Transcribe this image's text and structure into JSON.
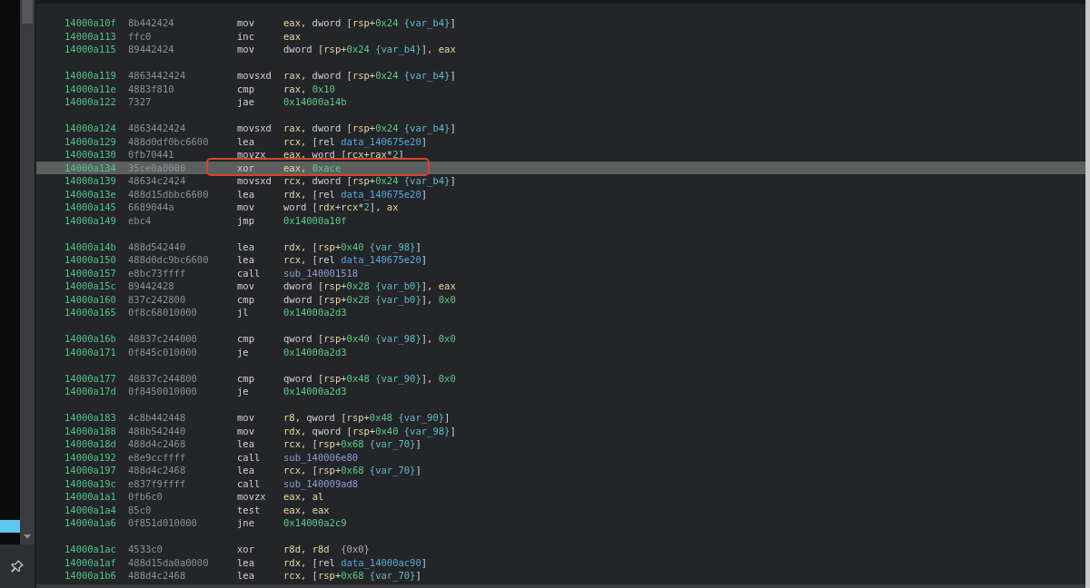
{
  "disassembly": {
    "blocks": [
      {
        "lines": [
          {
            "address": "14000a10f",
            "bytes": "8b442424",
            "mnemonic": "mov",
            "operands": [
              {
                "kind": "reg",
                "text": "eax"
              },
              {
                "kind": "p",
                "text": ", dword ["
              },
              {
                "kind": "reg",
                "text": "rsp"
              },
              {
                "kind": "p",
                "text": "+"
              },
              {
                "kind": "num",
                "text": "0x24"
              },
              {
                "kind": "var",
                "text": " {var_b4}"
              },
              {
                "kind": "p",
                "text": "]"
              }
            ],
            "selected": false,
            "marked": false
          },
          {
            "address": "14000a113",
            "bytes": "ffc0",
            "mnemonic": "inc",
            "operands": [
              {
                "kind": "reg",
                "text": "eax"
              }
            ],
            "selected": false,
            "marked": false
          },
          {
            "address": "14000a115",
            "bytes": "89442424",
            "mnemonic": "mov",
            "operands": [
              {
                "kind": "p",
                "text": "dword ["
              },
              {
                "kind": "reg",
                "text": "rsp"
              },
              {
                "kind": "p",
                "text": "+"
              },
              {
                "kind": "num",
                "text": "0x24"
              },
              {
                "kind": "var",
                "text": " {var_b4}"
              },
              {
                "kind": "p",
                "text": "], "
              },
              {
                "kind": "reg",
                "text": "eax"
              }
            ],
            "selected": false,
            "marked": false
          }
        ]
      },
      {
        "lines": [
          {
            "address": "14000a119",
            "bytes": "4863442424",
            "mnemonic": "movsxd",
            "operands": [
              {
                "kind": "reg",
                "text": "rax"
              },
              {
                "kind": "p",
                "text": ", dword ["
              },
              {
                "kind": "reg",
                "text": "rsp"
              },
              {
                "kind": "p",
                "text": "+"
              },
              {
                "kind": "num",
                "text": "0x24"
              },
              {
                "kind": "var",
                "text": " {var_b4}"
              },
              {
                "kind": "p",
                "text": "]"
              }
            ],
            "selected": false,
            "marked": false
          },
          {
            "address": "14000a11e",
            "bytes": "4883f810",
            "mnemonic": "cmp",
            "operands": [
              {
                "kind": "reg",
                "text": "rax"
              },
              {
                "kind": "p",
                "text": ", "
              },
              {
                "kind": "num",
                "text": "0x10"
              }
            ],
            "selected": false,
            "marked": false
          },
          {
            "address": "14000a122",
            "bytes": "7327",
            "mnemonic": "jae",
            "operands": [
              {
                "kind": "num",
                "text": "0x14000a14b"
              }
            ],
            "selected": false,
            "marked": false
          }
        ]
      },
      {
        "lines": [
          {
            "address": "14000a124",
            "bytes": "4863442424",
            "mnemonic": "movsxd",
            "operands": [
              {
                "kind": "reg",
                "text": "rax"
              },
              {
                "kind": "p",
                "text": ", dword ["
              },
              {
                "kind": "reg",
                "text": "rsp"
              },
              {
                "kind": "p",
                "text": "+"
              },
              {
                "kind": "num",
                "text": "0x24"
              },
              {
                "kind": "var",
                "text": " {var_b4}"
              },
              {
                "kind": "p",
                "text": "]"
              }
            ],
            "selected": false,
            "marked": false
          },
          {
            "address": "14000a129",
            "bytes": "488d0df0bc6600",
            "mnemonic": "lea",
            "operands": [
              {
                "kind": "reg",
                "text": "rcx"
              },
              {
                "kind": "p",
                "text": ", [rel "
              },
              {
                "kind": "data",
                "text": "data_140675e20"
              },
              {
                "kind": "p",
                "text": "]"
              }
            ],
            "selected": false,
            "marked": false
          },
          {
            "address": "14000a130",
            "bytes": "0fb70441",
            "mnemonic": "movzx",
            "operands": [
              {
                "kind": "reg",
                "text": "eax"
              },
              {
                "kind": "p",
                "text": ", word ["
              },
              {
                "kind": "reg",
                "text": "rcx"
              },
              {
                "kind": "p",
                "text": "+"
              },
              {
                "kind": "reg",
                "text": "rax"
              },
              {
                "kind": "p",
                "text": "*"
              },
              {
                "kind": "num",
                "text": "2"
              },
              {
                "kind": "p",
                "text": "]"
              }
            ],
            "selected": false,
            "marked": false
          },
          {
            "address": "14000a134",
            "bytes": "35ce0a0000",
            "mnemonic": "xor",
            "operands": [
              {
                "kind": "reg",
                "text": "eax"
              },
              {
                "kind": "p",
                "text": ", "
              },
              {
                "kind": "num",
                "text": "0xace"
              }
            ],
            "selected": true,
            "marked": true
          },
          {
            "address": "14000a139",
            "bytes": "48634c2424",
            "mnemonic": "movsxd",
            "operands": [
              {
                "kind": "reg",
                "text": "rcx"
              },
              {
                "kind": "p",
                "text": ", dword ["
              },
              {
                "kind": "reg",
                "text": "rsp"
              },
              {
                "kind": "p",
                "text": "+"
              },
              {
                "kind": "num",
                "text": "0x24"
              },
              {
                "kind": "var",
                "text": " {var_b4}"
              },
              {
                "kind": "p",
                "text": "]"
              }
            ],
            "selected": false,
            "marked": false
          },
          {
            "address": "14000a13e",
            "bytes": "488d15dbbc6600",
            "mnemonic": "lea",
            "operands": [
              {
                "kind": "reg",
                "text": "rdx"
              },
              {
                "kind": "p",
                "text": ", [rel "
              },
              {
                "kind": "data",
                "text": "data_140675e20"
              },
              {
                "kind": "p",
                "text": "]"
              }
            ],
            "selected": false,
            "marked": false
          },
          {
            "address": "14000a145",
            "bytes": "6689044a",
            "mnemonic": "mov",
            "operands": [
              {
                "kind": "p",
                "text": "word ["
              },
              {
                "kind": "reg",
                "text": "rdx"
              },
              {
                "kind": "p",
                "text": "+"
              },
              {
                "kind": "reg",
                "text": "rcx"
              },
              {
                "kind": "p",
                "text": "*"
              },
              {
                "kind": "num",
                "text": "2"
              },
              {
                "kind": "p",
                "text": "], "
              },
              {
                "kind": "reg",
                "text": "ax"
              }
            ],
            "selected": false,
            "marked": false
          },
          {
            "address": "14000a149",
            "bytes": "ebc4",
            "mnemonic": "jmp",
            "operands": [
              {
                "kind": "num",
                "text": "0x14000a10f"
              }
            ],
            "selected": false,
            "marked": false
          }
        ]
      },
      {
        "lines": [
          {
            "address": "14000a14b",
            "bytes": "488d542440",
            "mnemonic": "lea",
            "operands": [
              {
                "kind": "reg",
                "text": "rdx"
              },
              {
                "kind": "p",
                "text": ", ["
              },
              {
                "kind": "reg",
                "text": "rsp"
              },
              {
                "kind": "p",
                "text": "+"
              },
              {
                "kind": "num",
                "text": "0x40"
              },
              {
                "kind": "var",
                "text": " {var_98}"
              },
              {
                "kind": "p",
                "text": "]"
              }
            ],
            "selected": false,
            "marked": false
          },
          {
            "address": "14000a150",
            "bytes": "488d0dc9bc6600",
            "mnemonic": "lea",
            "operands": [
              {
                "kind": "reg",
                "text": "rcx"
              },
              {
                "kind": "p",
                "text": ", [rel "
              },
              {
                "kind": "data",
                "text": "data_140675e20"
              },
              {
                "kind": "p",
                "text": "]"
              }
            ],
            "selected": false,
            "marked": false
          },
          {
            "address": "14000a157",
            "bytes": "e8bc73ffff",
            "mnemonic": "call",
            "operands": [
              {
                "kind": "func",
                "text": "sub_140001518"
              }
            ],
            "selected": false,
            "marked": false
          },
          {
            "address": "14000a15c",
            "bytes": "89442428",
            "mnemonic": "mov",
            "operands": [
              {
                "kind": "p",
                "text": "dword ["
              },
              {
                "kind": "reg",
                "text": "rsp"
              },
              {
                "kind": "p",
                "text": "+"
              },
              {
                "kind": "num",
                "text": "0x28"
              },
              {
                "kind": "var",
                "text": " {var_b0}"
              },
              {
                "kind": "p",
                "text": "], "
              },
              {
                "kind": "reg",
                "text": "eax"
              }
            ],
            "selected": false,
            "marked": false
          },
          {
            "address": "14000a160",
            "bytes": "837c242800",
            "mnemonic": "cmp",
            "operands": [
              {
                "kind": "p",
                "text": "dword ["
              },
              {
                "kind": "reg",
                "text": "rsp"
              },
              {
                "kind": "p",
                "text": "+"
              },
              {
                "kind": "num",
                "text": "0x28"
              },
              {
                "kind": "var",
                "text": " {var_b0}"
              },
              {
                "kind": "p",
                "text": "], "
              },
              {
                "kind": "num",
                "text": "0x0"
              }
            ],
            "selected": false,
            "marked": false
          },
          {
            "address": "14000a165",
            "bytes": "0f8c68010000",
            "mnemonic": "jl",
            "operands": [
              {
                "kind": "num",
                "text": "0x14000a2d3"
              }
            ],
            "selected": false,
            "marked": false
          }
        ]
      },
      {
        "lines": [
          {
            "address": "14000a16b",
            "bytes": "48837c244000",
            "mnemonic": "cmp",
            "operands": [
              {
                "kind": "p",
                "text": "qword ["
              },
              {
                "kind": "reg",
                "text": "rsp"
              },
              {
                "kind": "p",
                "text": "+"
              },
              {
                "kind": "num",
                "text": "0x40"
              },
              {
                "kind": "var",
                "text": " {var_98}"
              },
              {
                "kind": "p",
                "text": "], "
              },
              {
                "kind": "num",
                "text": "0x0"
              }
            ],
            "selected": false,
            "marked": false
          },
          {
            "address": "14000a171",
            "bytes": "0f845c010000",
            "mnemonic": "je",
            "operands": [
              {
                "kind": "num",
                "text": "0x14000a2d3"
              }
            ],
            "selected": false,
            "marked": false
          }
        ]
      },
      {
        "lines": [
          {
            "address": "14000a177",
            "bytes": "48837c244800",
            "mnemonic": "cmp",
            "operands": [
              {
                "kind": "p",
                "text": "qword ["
              },
              {
                "kind": "reg",
                "text": "rsp"
              },
              {
                "kind": "p",
                "text": "+"
              },
              {
                "kind": "num",
                "text": "0x48"
              },
              {
                "kind": "var",
                "text": " {var_90}"
              },
              {
                "kind": "p",
                "text": "], "
              },
              {
                "kind": "num",
                "text": "0x0"
              }
            ],
            "selected": false,
            "marked": false
          },
          {
            "address": "14000a17d",
            "bytes": "0f8450010000",
            "mnemonic": "je",
            "operands": [
              {
                "kind": "num",
                "text": "0x14000a2d3"
              }
            ],
            "selected": false,
            "marked": false
          }
        ]
      },
      {
        "lines": [
          {
            "address": "14000a183",
            "bytes": "4c8b442448",
            "mnemonic": "mov",
            "operands": [
              {
                "kind": "reg",
                "text": "r8"
              },
              {
                "kind": "p",
                "text": ", qword ["
              },
              {
                "kind": "reg",
                "text": "rsp"
              },
              {
                "kind": "p",
                "text": "+"
              },
              {
                "kind": "num",
                "text": "0x48"
              },
              {
                "kind": "var",
                "text": " {var_90}"
              },
              {
                "kind": "p",
                "text": "]"
              }
            ],
            "selected": false,
            "marked": false
          },
          {
            "address": "14000a188",
            "bytes": "488b542440",
            "mnemonic": "mov",
            "operands": [
              {
                "kind": "reg",
                "text": "rdx"
              },
              {
                "kind": "p",
                "text": ", qword ["
              },
              {
                "kind": "reg",
                "text": "rsp"
              },
              {
                "kind": "p",
                "text": "+"
              },
              {
                "kind": "num",
                "text": "0x40"
              },
              {
                "kind": "var",
                "text": " {var_98}"
              },
              {
                "kind": "p",
                "text": "]"
              }
            ],
            "selected": false,
            "marked": false
          },
          {
            "address": "14000a18d",
            "bytes": "488d4c2468",
            "mnemonic": "lea",
            "operands": [
              {
                "kind": "reg",
                "text": "rcx"
              },
              {
                "kind": "p",
                "text": ", ["
              },
              {
                "kind": "reg",
                "text": "rsp"
              },
              {
                "kind": "p",
                "text": "+"
              },
              {
                "kind": "num",
                "text": "0x68"
              },
              {
                "kind": "var",
                "text": " {var_70}"
              },
              {
                "kind": "p",
                "text": "]"
              }
            ],
            "selected": false,
            "marked": false
          },
          {
            "address": "14000a192",
            "bytes": "e8e9ccffff",
            "mnemonic": "call",
            "operands": [
              {
                "kind": "func",
                "text": "sub_140006e80"
              }
            ],
            "selected": false,
            "marked": false
          },
          {
            "address": "14000a197",
            "bytes": "488d4c2468",
            "mnemonic": "lea",
            "operands": [
              {
                "kind": "reg",
                "text": "rcx"
              },
              {
                "kind": "p",
                "text": ", ["
              },
              {
                "kind": "reg",
                "text": "rsp"
              },
              {
                "kind": "p",
                "text": "+"
              },
              {
                "kind": "num",
                "text": "0x68"
              },
              {
                "kind": "var",
                "text": " {var_70}"
              },
              {
                "kind": "p",
                "text": "]"
              }
            ],
            "selected": false,
            "marked": false
          },
          {
            "address": "14000a19c",
            "bytes": "e837f9ffff",
            "mnemonic": "call",
            "operands": [
              {
                "kind": "func",
                "text": "sub_140009ad8"
              }
            ],
            "selected": false,
            "marked": false
          },
          {
            "address": "14000a1a1",
            "bytes": "0fb6c0",
            "mnemonic": "movzx",
            "operands": [
              {
                "kind": "reg",
                "text": "eax"
              },
              {
                "kind": "p",
                "text": ", "
              },
              {
                "kind": "reg",
                "text": "al"
              }
            ],
            "selected": false,
            "marked": false
          },
          {
            "address": "14000a1a4",
            "bytes": "85c0",
            "mnemonic": "test",
            "operands": [
              {
                "kind": "reg",
                "text": "eax"
              },
              {
                "kind": "p",
                "text": ", "
              },
              {
                "kind": "reg",
                "text": "eax"
              }
            ],
            "selected": false,
            "marked": false
          },
          {
            "address": "14000a1a6",
            "bytes": "0f851d010000",
            "mnemonic": "jne",
            "operands": [
              {
                "kind": "num",
                "text": "0x14000a2c9"
              }
            ],
            "selected": false,
            "marked": false
          }
        ]
      },
      {
        "lines": [
          {
            "address": "14000a1ac",
            "bytes": "4533c0",
            "mnemonic": "xor",
            "operands": [
              {
                "kind": "reg",
                "text": "r8d"
              },
              {
                "kind": "p",
                "text": ", "
              },
              {
                "kind": "reg",
                "text": "r8d"
              },
              {
                "kind": "cmt",
                "text": "  {0x0}"
              }
            ],
            "selected": false,
            "marked": false
          },
          {
            "address": "14000a1af",
            "bytes": "488d15da0a0000",
            "mnemonic": "lea",
            "operands": [
              {
                "kind": "reg",
                "text": "rdx"
              },
              {
                "kind": "p",
                "text": ", [rel "
              },
              {
                "kind": "data",
                "text": "data_14000ac90"
              },
              {
                "kind": "p",
                "text": "]"
              }
            ],
            "selected": false,
            "marked": false
          },
          {
            "address": "14000a1b6",
            "bytes": "488d4c2468",
            "mnemonic": "lea",
            "operands": [
              {
                "kind": "reg",
                "text": "rcx"
              },
              {
                "kind": "p",
                "text": ", ["
              },
              {
                "kind": "reg",
                "text": "rsp"
              },
              {
                "kind": "p",
                "text": "+"
              },
              {
                "kind": "num",
                "text": "0x68"
              },
              {
                "kind": "var",
                "text": " {var_70}"
              },
              {
                "kind": "p",
                "text": "]"
              }
            ],
            "selected": false,
            "marked": false
          }
        ]
      }
    ]
  }
}
